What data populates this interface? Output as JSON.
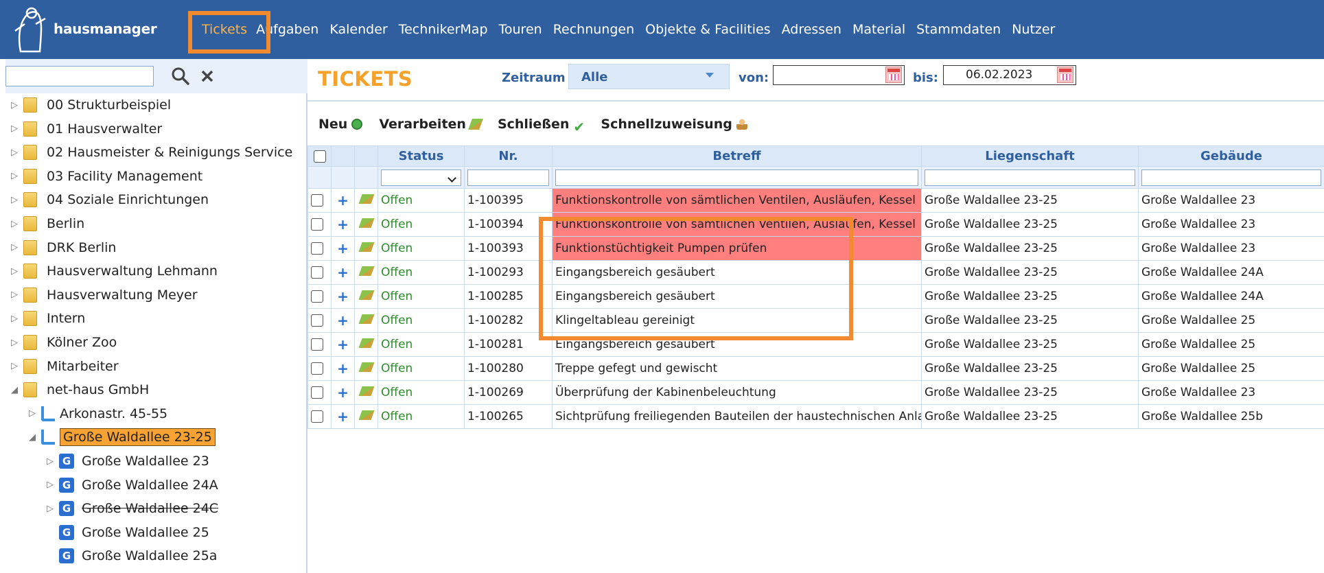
{
  "app": {
    "brand": "hausmanager"
  },
  "nav": {
    "items": [
      "Tickets",
      "Aufgaben",
      "Kalender",
      "TechnikerMap",
      "Touren",
      "Rechnungen",
      "Objekte & Facilities",
      "Adressen",
      "Material",
      "Stammdaten",
      "Nutzer"
    ],
    "active": "Tickets"
  },
  "sidebar": {
    "search": {
      "value": ""
    },
    "tree": [
      {
        "label": "00 Strukturbeispiel",
        "type": "folder",
        "level": 0,
        "expanded": false
      },
      {
        "label": "01 Hausverwalter",
        "type": "folder",
        "level": 0,
        "expanded": false
      },
      {
        "label": "02 Hausmeister & Reinigungs Service",
        "type": "folder",
        "level": 0,
        "expanded": false
      },
      {
        "label": "03 Facility Management",
        "type": "folder",
        "level": 0,
        "expanded": false
      },
      {
        "label": "04 Soziale Einrichtungen",
        "type": "folder",
        "level": 0,
        "expanded": false
      },
      {
        "label": "Berlin",
        "type": "folder",
        "level": 0,
        "expanded": false
      },
      {
        "label": "DRK Berlin",
        "type": "folder",
        "level": 0,
        "expanded": false
      },
      {
        "label": "Hausverwaltung Lehmann",
        "type": "folder",
        "level": 0,
        "expanded": false
      },
      {
        "label": "Hausverwaltung Meyer",
        "type": "folder",
        "level": 0,
        "expanded": false
      },
      {
        "label": "Intern",
        "type": "folder",
        "level": 0,
        "expanded": false
      },
      {
        "label": "Kölner Zoo",
        "type": "folder",
        "level": 0,
        "expanded": false
      },
      {
        "label": "Mitarbeiter",
        "type": "folder",
        "level": 0,
        "expanded": false
      },
      {
        "label": "net-haus GmbH",
        "type": "folder",
        "level": 0,
        "expanded": true
      },
      {
        "label": "Arkonastr. 45-55",
        "type": "property",
        "level": 1,
        "expanded": false
      },
      {
        "label": "Große Waldallee 23-25",
        "type": "property",
        "level": 1,
        "expanded": true,
        "selected": true
      },
      {
        "label": "Große Waldallee 23",
        "type": "building",
        "level": 2,
        "expanded": false
      },
      {
        "label": "Große Waldallee 24A",
        "type": "building",
        "level": 2,
        "expanded": false
      },
      {
        "label": "Große Waldallee 24C",
        "type": "building",
        "level": 2,
        "expanded": false,
        "strikethrough": true
      },
      {
        "label": "Große Waldallee 25",
        "type": "building",
        "level": 2,
        "leaf": true
      },
      {
        "label": "Große Waldallee 25a",
        "type": "building",
        "level": 2,
        "leaf": true
      }
    ]
  },
  "main": {
    "title": "TICKETS",
    "zeitraum_label": "Zeitraum",
    "zeitraum_value": "Alle",
    "von_label": "von:",
    "von_value": "",
    "bis_label": "bis:",
    "bis_value": "06.02.2023",
    "toolbar": {
      "neu": "Neu",
      "verarbeiten": "Verarbeiten",
      "schliessen": "Schließen",
      "schnellzuweisung": "Schnellzuweisung"
    },
    "columns": [
      "Status",
      "Nr.",
      "Betreff",
      "Liegenschaft",
      "Gebäude"
    ],
    "rows": [
      {
        "status": "Offen",
        "nr": "1-100395",
        "betreff": "Funktionskontrolle von sämtlichen Ventilen, Ausläufen, Kessel",
        "liegenschaft": "Große Waldallee 23-25",
        "gebaeude": "Große Waldallee 23",
        "highlight": true
      },
      {
        "status": "Offen",
        "nr": "1-100394",
        "betreff": "Funktionskontrolle von sämtlichen Ventilen, Ausläufen, Kessel",
        "liegenschaft": "Große Waldallee 23-25",
        "gebaeude": "Große Waldallee 23",
        "highlight": true
      },
      {
        "status": "Offen",
        "nr": "1-100393",
        "betreff": "Funktionstüchtigkeit Pumpen prüfen",
        "liegenschaft": "Große Waldallee 23-25",
        "gebaeude": "Große Waldallee 23",
        "highlight": true
      },
      {
        "status": "Offen",
        "nr": "1-100293",
        "betreff": "Eingangsbereich gesäubert",
        "liegenschaft": "Große Waldallee 23-25",
        "gebaeude": "Große Waldallee 24A"
      },
      {
        "status": "Offen",
        "nr": "1-100285",
        "betreff": "Eingangsbereich gesäubert",
        "liegenschaft": "Große Waldallee 23-25",
        "gebaeude": "Große Waldallee 24A"
      },
      {
        "status": "Offen",
        "nr": "1-100282",
        "betreff": "Klingeltableau gereinigt",
        "liegenschaft": "Große Waldallee 23-25",
        "gebaeude": "Große Waldallee 25"
      },
      {
        "status": "Offen",
        "nr": "1-100281",
        "betreff": "Eingangsbereich gesäubert",
        "liegenschaft": "Große Waldallee 23-25",
        "gebaeude": "Große Waldallee 25"
      },
      {
        "status": "Offen",
        "nr": "1-100280",
        "betreff": "Treppe gefegt und gewischt",
        "liegenschaft": "Große Waldallee 23-25",
        "gebaeude": "Große Waldallee 25"
      },
      {
        "status": "Offen",
        "nr": "1-100269",
        "betreff": "Überprüfung der Kabinenbeleuchtung",
        "liegenschaft": "Große Waldallee 23-25",
        "gebaeude": "Große Waldallee 23"
      },
      {
        "status": "Offen",
        "nr": "1-100265",
        "betreff": "Sichtprüfung freiliegenden Bauteilen der haustechnischen Anla",
        "liegenschaft": "Große Waldallee 23-25",
        "gebaeude": "Große Waldallee 25b"
      }
    ]
  },
  "colors": {
    "nav_bg": "#2f5f9e",
    "accent_orange": "#f28a30",
    "title_orange": "#f4a22c",
    "highlight_red": "#ff7f7f",
    "status_green": "#2e8b2e"
  }
}
